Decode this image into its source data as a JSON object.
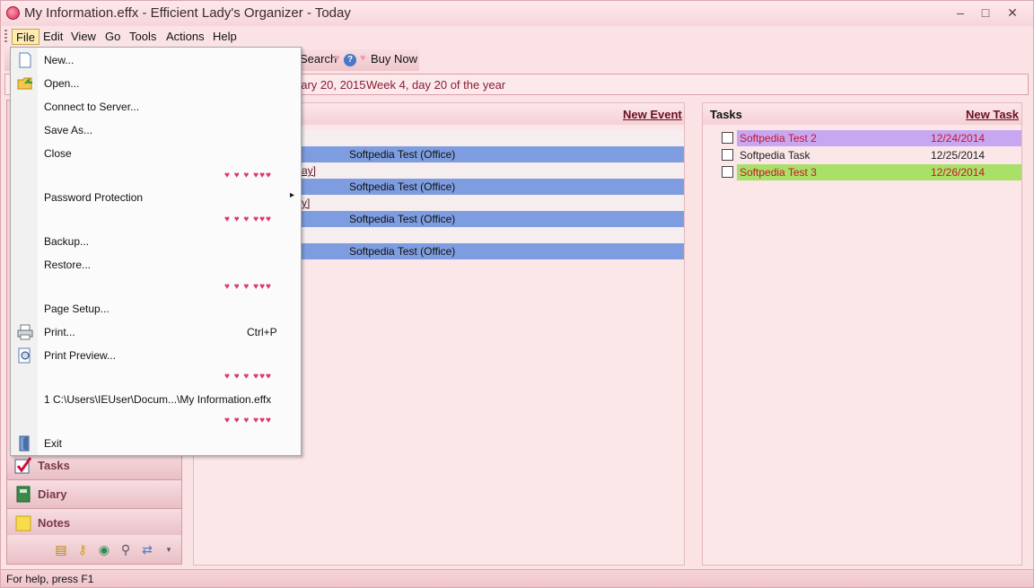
{
  "window": {
    "title": "My Information.effx - Efficient Lady's Organizer - Today",
    "controls": {
      "minimize": "–",
      "maximize": "□",
      "close": "✕"
    }
  },
  "menubar": {
    "items": [
      "File",
      "Edit",
      "View",
      "Go",
      "Tools",
      "Actions",
      "Help"
    ]
  },
  "toolbar": {
    "search_label": "Search",
    "help_icon": "?",
    "buy_label": "Buy Now",
    "heart": "♥"
  },
  "date_banner": {
    "fragment": "nary 20, 2015",
    "week": "Week 4, day 20 of the year"
  },
  "events": {
    "new_label": "New Event",
    "rows": [
      {
        "text": "Softpedia Test (Office)"
      },
      {
        "text": "ay]"
      },
      {
        "text": "Softpedia Test (Office)"
      },
      {
        "text": "y]"
      },
      {
        "text": "Softpedia Test (Office)"
      },
      {
        "text": "Softpedia Test (Office)"
      }
    ]
  },
  "tasks": {
    "header": "Tasks",
    "new_label": "New Task",
    "items": [
      {
        "name": "Softpedia Test 2",
        "date": "12/24/2014",
        "color": "#c7a8f0",
        "text_color": "#d01030"
      },
      {
        "name": "Softpedia Task",
        "date": "12/25/2014",
        "color": "",
        "text_color": "#111111"
      },
      {
        "name": "Softpedia Test 3",
        "date": "12/26/2014",
        "color": "#a8e068",
        "text_color": "#d01030"
      }
    ]
  },
  "leftnav": {
    "items": [
      {
        "label": "Tasks",
        "icon": "checkmark-icon"
      },
      {
        "label": "Diary",
        "icon": "diary-icon"
      },
      {
        "label": "Notes",
        "icon": "notes-icon"
      }
    ]
  },
  "statusbar": {
    "text": "For help, press F1"
  },
  "file_menu": {
    "items": [
      {
        "label": "New...",
        "icon": "new-document-icon"
      },
      {
        "label": "Open...",
        "icon": "open-folder-icon"
      },
      {
        "label": "Connect to Server..."
      },
      {
        "label": "Save As..."
      },
      {
        "label": "Close"
      },
      {
        "label": "Password Protection",
        "submenu": "▸"
      },
      {
        "label": "Backup..."
      },
      {
        "label": "Restore..."
      },
      {
        "label": "Page Setup..."
      },
      {
        "label": "Print...",
        "shortcut": "Ctrl+P",
        "icon": "printer-icon"
      },
      {
        "label": "Print Preview...",
        "icon": "print-preview-icon"
      },
      {
        "label": "1 C:\\Users\\IEUser\\Docum...\\My Information.effx"
      },
      {
        "label": "Exit",
        "icon": "exit-door-icon"
      }
    ],
    "separator_glyph": "♥ ♥ ♥ ♥♥♥"
  }
}
